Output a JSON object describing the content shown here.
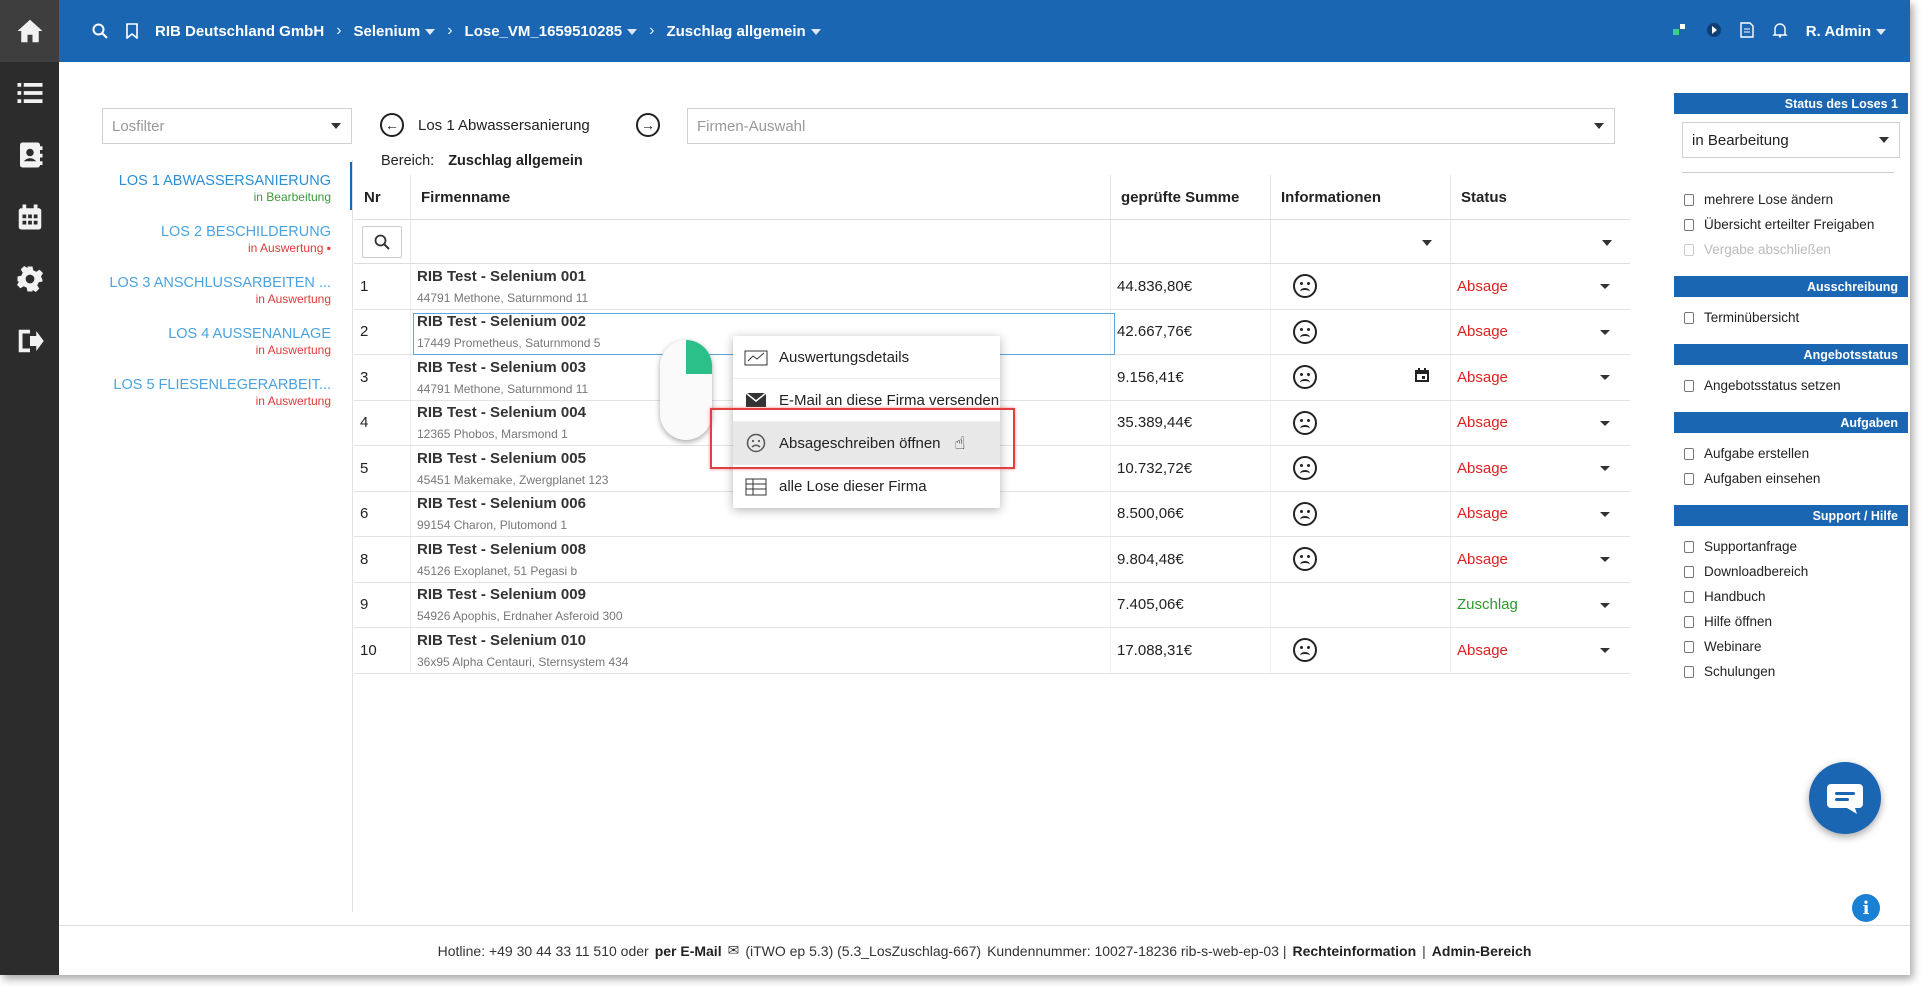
{
  "topbar": {
    "crumbs": [
      "RIB Deutschland GmbH",
      "Selenium",
      "Lose_VM_1659510285",
      "Zuschlag allgemein"
    ],
    "user": "R. Admin"
  },
  "losfilter": {
    "placeholder": "Losfilter"
  },
  "lots": [
    {
      "name": "LOS 1 ABWASSERSANIERUNG",
      "status": "in Bearbeitung"
    },
    {
      "name": "LOS 2 BESCHILDERUNG",
      "status": "in Auswertung"
    },
    {
      "name": "LOS 3 ANSCHLUSSARBEITEN ...",
      "status": "in Auswertung"
    },
    {
      "name": "LOS 4 AUSSENANLAGE",
      "status": "in Auswertung"
    },
    {
      "name": "LOS 5 FLIESENLEGERARBEIT...",
      "status": "in Auswertung"
    }
  ],
  "nav": {
    "current_lot": "Los 1 Abwassersanierung",
    "firm_select": "Firmen-Auswahl"
  },
  "bereich": {
    "label": "Bereich:",
    "value": "Zuschlag allgemein"
  },
  "table": {
    "headers": [
      "Nr",
      "Firmenname",
      "geprüfte Summe",
      "Informationen",
      "Status"
    ],
    "rows": [
      {
        "nr": "1",
        "name": "RIB Test - Selenium 001",
        "addr": "44791 Methone, Saturnmond 11",
        "sum": "44.836,80€",
        "status": "Absage",
        "sad": true
      },
      {
        "nr": "2",
        "name": "RIB Test - Selenium 002",
        "addr": "17449 Prometheus, Saturnmond 5",
        "sum": "42.667,76€",
        "status": "Absage",
        "sad": true
      },
      {
        "nr": "3",
        "name": "RIB Test - Selenium 003",
        "addr": "44791 Methone, Saturnmond 11",
        "sum": "9.156,41€",
        "status": "Absage",
        "sad": true,
        "cal": true
      },
      {
        "nr": "4",
        "name": "RIB Test - Selenium 004",
        "addr": "12365 Phobos, Marsmond 1",
        "sum": "35.389,44€",
        "status": "Absage",
        "sad": true
      },
      {
        "nr": "5",
        "name": "RIB Test - Selenium 005",
        "addr": "45451 Makemake, Zwergplanet 123",
        "sum": "10.732,72€",
        "status": "Absage",
        "sad": true
      },
      {
        "nr": "6",
        "name": "RIB Test - Selenium 006",
        "addr": "99154 Charon, Plutomond 1",
        "sum": "8.500,06€",
        "status": "Absage",
        "sad": true
      },
      {
        "nr": "8",
        "name": "RIB Test - Selenium 008",
        "addr": "45126 Exoplanet, 51 Pegasi b",
        "sum": "9.804,48€",
        "status": "Absage",
        "sad": true
      },
      {
        "nr": "9",
        "name": "RIB Test - Selenium 009",
        "addr": "54926 Apophis, Erdnaher Asferoid 300",
        "sum": "7.405,06€",
        "status": "Zuschlag",
        "sad": false
      },
      {
        "nr": "10",
        "name": "RIB Test - Selenium 010",
        "addr": "36x95 Alpha Centauri, Sternsystem 434",
        "sum": "17.088,31€",
        "status": "Absage",
        "sad": true
      }
    ]
  },
  "context_menu": {
    "items": [
      "Auswertungsdetails",
      "E-Mail an diese Firma versenden",
      "Absageschreiben öffnen",
      "alle Lose dieser Firma"
    ]
  },
  "right_panel": {
    "status_head": "Status des Loses 1",
    "status_value": "in Bearbeitung",
    "status_actions": [
      "mehrere Lose ändern",
      "Übersicht erteilter Freigaben",
      "Vergabe abschließen"
    ],
    "ausschreibung_head": "Ausschreibung",
    "ausschreibung_items": [
      "Terminübersicht"
    ],
    "angebot_head": "Angebotsstatus",
    "angebot_items": [
      "Angebotsstatus setzen"
    ],
    "aufgaben_head": "Aufgaben",
    "aufgaben_items": [
      "Aufgabe erstellen",
      "Aufgaben einsehen"
    ],
    "support_head": "Support / Hilfe",
    "support_items": [
      "Supportanfrage",
      "Downloadbereich",
      "Handbuch",
      "Hilfe öffnen",
      "Webinare",
      "Schulungen"
    ]
  },
  "footer": {
    "hotline": "Hotline: +49 30 44 33 11 510 oder",
    "email": "per E-Mail",
    "version": "(iTWO ep 5.3) (5.3_LosZuschlag-667)",
    "kunden": "Kundennummer: 10027-18236 rib-s-web-ep-03 |",
    "recht": "Rechteinformation",
    "pipe": "|",
    "admin": "Admin-Bereich"
  }
}
